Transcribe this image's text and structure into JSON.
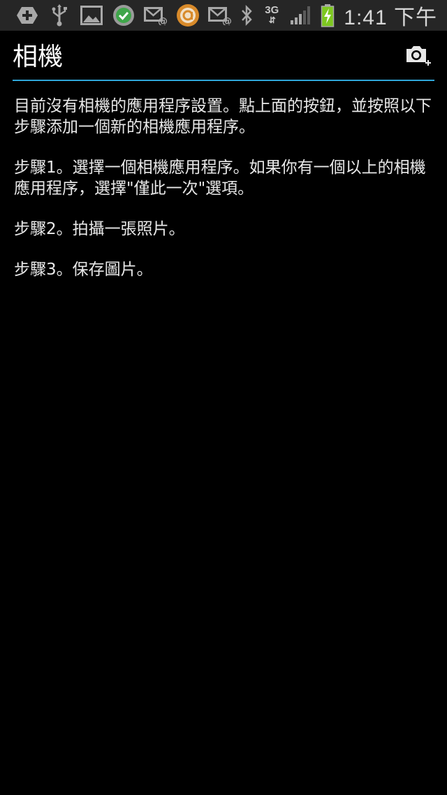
{
  "status_bar": {
    "icons": [
      "add-circle-icon",
      "usb-icon",
      "image-icon",
      "check-circle-icon",
      "email-icon",
      "orange-circle-app-icon",
      "email-icon"
    ],
    "right_icons": [
      "bluetooth-icon",
      "signal-icon",
      "battery-charging-icon"
    ],
    "network_type": "3G",
    "network_arrows": "⇵",
    "time": "1:41 下午"
  },
  "action_bar": {
    "title": "相機",
    "action_icon": "add-camera-icon"
  },
  "colors": {
    "background": "#000000",
    "status_bar": "#262626",
    "divider_accent": "#2fa6d8",
    "text": "#e8e8e8"
  },
  "content": {
    "paragraphs": [
      "目前沒有相機的應用程序設置。點上面的按鈕，並按照以下步驟添加一個新的相機應用程序。",
      "步驟1。選擇一個相機應用程序。如果你有一個以上的相機應用程序，選擇\"僅此一次\"選項。",
      "步驟2。拍攝一張照片。",
      "步驟3。保存圖片。"
    ]
  }
}
